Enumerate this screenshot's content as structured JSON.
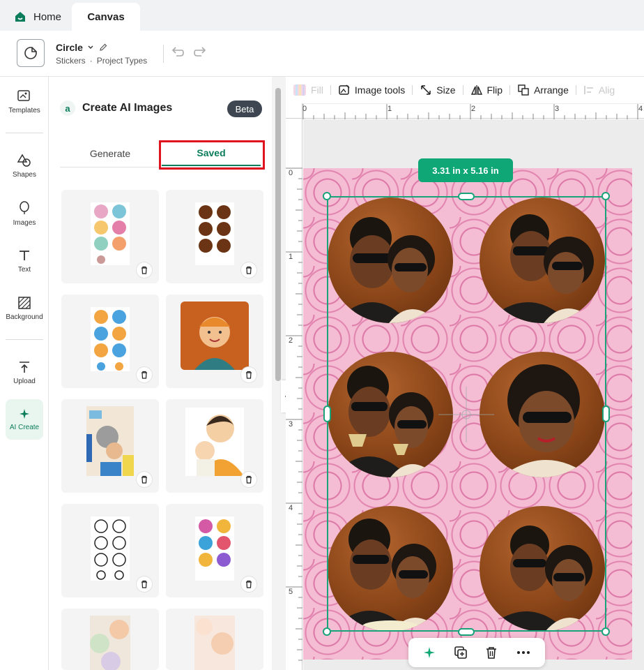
{
  "tabs": {
    "home": "Home",
    "canvas": "Canvas"
  },
  "project": {
    "name": "Circle",
    "category": "Stickers",
    "dot": "·",
    "type": "Project Types"
  },
  "rail": {
    "templates": "Templates",
    "shapes": "Shapes",
    "images": "Images",
    "text": "Text",
    "background": "Background",
    "upload": "Upload",
    "ai_create": "AI Create"
  },
  "panel": {
    "logo": "a",
    "title": "Create AI Images",
    "badge": "Beta",
    "tab_generate": "Generate",
    "tab_saved": "Saved"
  },
  "toolbar": {
    "fill": "Fill",
    "image_tools": "Image tools",
    "size": "Size",
    "flip": "Flip",
    "arrange": "Arrange",
    "align": "Alig"
  },
  "ruler": {
    "top": [
      "0",
      "1",
      "2",
      "3",
      "4"
    ],
    "left": [
      "0",
      "1",
      "2",
      "3",
      "4",
      "5"
    ]
  },
  "selection": {
    "size_label": "3.31 in x 5.16 in"
  },
  "colors": {
    "accent": "#0b7d5a",
    "selection": "#18a37a",
    "badge": "#0fa776",
    "highlight": "#e0141e"
  }
}
